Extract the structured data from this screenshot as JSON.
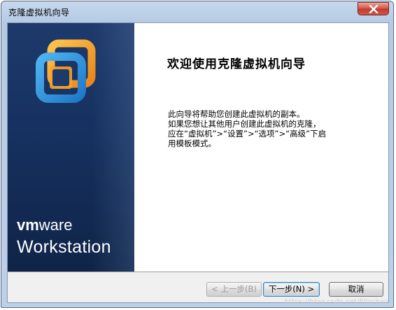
{
  "window": {
    "title": "克隆虚拟机向导",
    "close_icon": "close-icon"
  },
  "banner": {
    "logo_icon": "vmware-workstation-logo-icon",
    "brand_vm": "vm",
    "brand_ware": "ware",
    "product": "Workstation",
    "colors": {
      "background": "#163160",
      "logo_blue": "#2a8fd8",
      "logo_orange": "#f29a1e"
    }
  },
  "content": {
    "heading": "欢迎使用克隆虚拟机向导",
    "lines": [
      "此向导将帮助您创建此虚拟机的副本。",
      "如果您想让其他用户创建此虚拟机的克隆，",
      "应在“虚拟机”>“设置”>“选项”>“高级”下启",
      "用模板模式。"
    ]
  },
  "buttons": {
    "back": "< 上一步(B)",
    "next": "下一步(N) >",
    "cancel": "取消"
  },
  "watermark": "https://blog.csdn.net/Ellochan"
}
